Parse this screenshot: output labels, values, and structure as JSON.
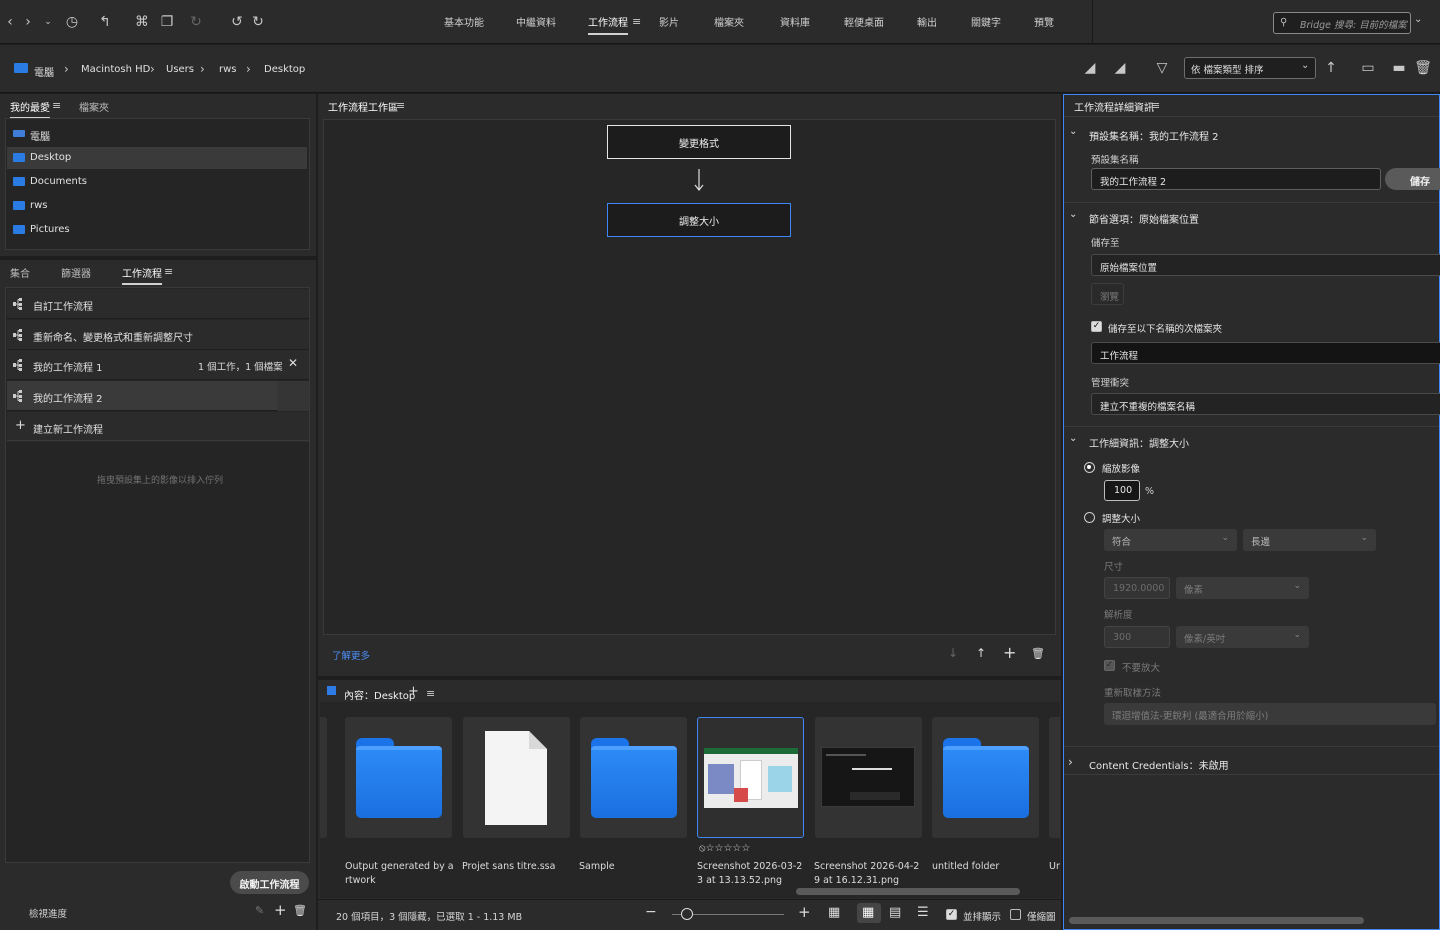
{
  "workspaces": [
    "基本功能",
    "中繼資料",
    "工作流程",
    "影片",
    "檔案夾",
    "資料庫",
    "輕便桌面",
    "輸出",
    "關鍵字",
    "預覽"
  ],
  "search": {
    "placeholder": "Bridge 搜尋: 目前的檔案"
  },
  "breadcrumb": [
    "電腦",
    "Macintosh HD",
    "Users",
    "rws",
    "Desktop"
  ],
  "sort": {
    "label": "依 檔案類型 排序"
  },
  "favorites": {
    "tabs": [
      "我的最愛",
      "檔案夾"
    ],
    "items": [
      "電腦",
      "Desktop",
      "Documents",
      "rws",
      "Pictures"
    ]
  },
  "lower_tabs": [
    "集合",
    "篩選器",
    "工作流程"
  ],
  "workflows": {
    "items": [
      {
        "label": "自訂工作流程",
        "meta": ""
      },
      {
        "label": "重新命名、變更格式和重新調整尺寸",
        "meta": ""
      },
      {
        "label": "我的工作流程 1",
        "meta": "1 個工作，1 個檔案"
      },
      {
        "label": "我的工作流程 2",
        "meta": ""
      }
    ],
    "new_label": "建立新工作流程",
    "drop_hint": "拖曳預設集上的影像以排入佇列",
    "start_button": "啟動工作流程",
    "progress_label": "檢視進度"
  },
  "workbench": {
    "title": "工作流程工作區",
    "nodes": [
      "變更格式",
      "調整大小"
    ],
    "learn_more": "了解更多"
  },
  "content": {
    "title": "內容：Desktop",
    "items": [
      {
        "label": "Output generated by artwork",
        "kind": "folder"
      },
      {
        "label": "Projet sans titre.ssa",
        "kind": "file"
      },
      {
        "label": "Sample",
        "kind": "folder"
      },
      {
        "label": "Screenshot 2026-03-23 at 13.13.52.png",
        "kind": "image"
      },
      {
        "label": "Screenshot 2026-04-29 at 16.12.31.png",
        "kind": "image-dark"
      },
      {
        "label": "untitled folder",
        "kind": "folder"
      },
      {
        "label": "Ur",
        "kind": "partial"
      }
    ],
    "status": "20 個項目，3 個隱藏，已選取 1 - 1.13 MB",
    "opt_stack": "並排顯示",
    "opt_lock": "僅縮圖"
  },
  "details": {
    "title": "工作流程詳細資訊",
    "preset_section": "預設集名稱：我的工作流程 2",
    "preset_label": "預設集名稱",
    "preset_value": "我的工作流程 2",
    "save_button": "儲存",
    "save_section": "節省選項：原始檔案位置",
    "save_to_label": "儲存至",
    "save_to_value": "原始檔案位置",
    "browse_button": "瀏覽",
    "subfolder_check": "儲存至以下名稱的次檔案夾",
    "subfolder_value": "工作流程",
    "conflict_label": "管理衝突",
    "conflict_value": "建立不重複的檔案名稱",
    "job_section": "工作細資訊：調整大小",
    "scale_radio": "縮放影像",
    "scale_value": "100",
    "scale_unit": "%",
    "resize_radio": "調整大小",
    "fit_value": "符合",
    "edge_value": "長邊",
    "dim_label": "尺寸",
    "dim_value": "1920.0000",
    "dim_unit": "像素",
    "res_label": "解析度",
    "res_value": "300",
    "res_unit": "像素/英吋",
    "no_enlarge": "不要放大",
    "resample_label": "重新取樣方法",
    "resample_value": "環迴增值法-更銳利 (最適合用於縮小)",
    "cc_section": "Content Credentials：未啟用"
  }
}
